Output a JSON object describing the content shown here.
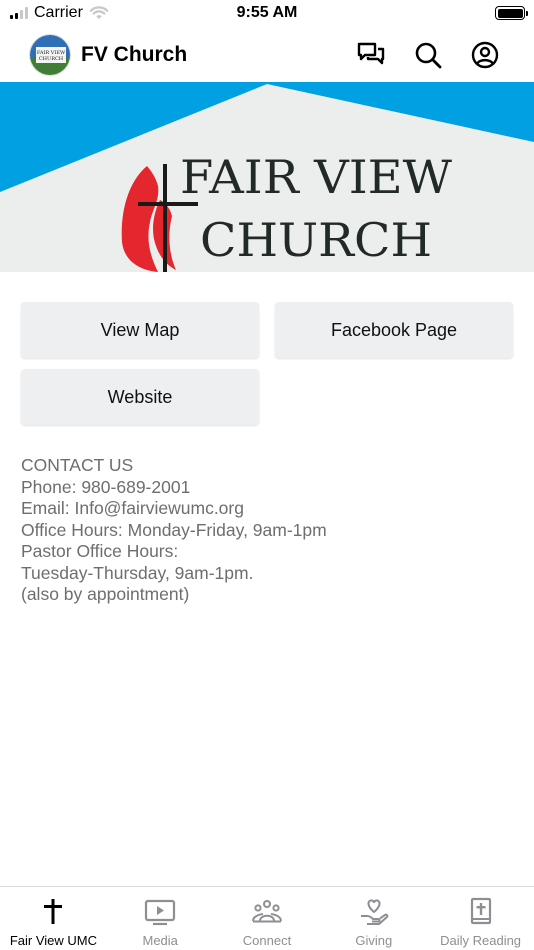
{
  "status_bar": {
    "carrier": "Carrier",
    "time": "9:55 AM"
  },
  "header": {
    "logo_text": "FAIR VIEW CHURCH",
    "title": "FV Church"
  },
  "hero": {
    "line1": "FAIR VIEW",
    "line2": "CHURCH",
    "colors": {
      "accent_blue": "#00a0e3",
      "flame_red": "#e4262e"
    }
  },
  "buttons": {
    "view_map": "View Map",
    "facebook": "Facebook Page",
    "website": "Website"
  },
  "contact": {
    "heading": "CONTACT US",
    "phone": "Phone: 980-689-2001",
    "email": "Email: Info@fairviewumc.org",
    "office_hours": "Office Hours: Monday-Friday, 9am-1pm",
    "pastor_label": "Pastor Office Hours:",
    "pastor_hours": "Tuesday-Thursday, 9am-1pm.",
    "note": "(also by appointment)"
  },
  "tabs": [
    {
      "label": "Fair View UMC",
      "icon": "cross-icon",
      "active": true
    },
    {
      "label": "Media",
      "icon": "play-screen-icon",
      "active": false
    },
    {
      "label": "Connect",
      "icon": "people-group-icon",
      "active": false
    },
    {
      "label": "Giving",
      "icon": "hand-heart-icon",
      "active": false
    },
    {
      "label": "Daily Reading",
      "icon": "bible-icon",
      "active": false
    }
  ]
}
